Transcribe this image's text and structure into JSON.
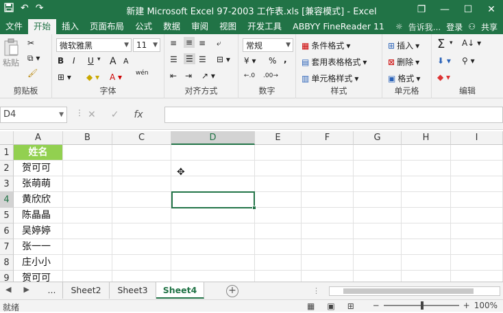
{
  "titlebar": {
    "title": "新建 Microsoft Excel 97-2003 工作表.xls  [兼容模式] - Excel",
    "save_icon": "save-icon",
    "undo": "↶",
    "redo": "↷",
    "restore": "❐",
    "minimize": "—",
    "maximize": "☐",
    "close": "✕"
  },
  "menu": {
    "tabs": [
      "文件",
      "开始",
      "插入",
      "页面布局",
      "公式",
      "数据",
      "审阅",
      "视图",
      "开发工具",
      "ABBYY FineReader 11"
    ],
    "active_tab": "开始",
    "tell_me": "告诉我...",
    "login": "登录",
    "share": "共享"
  },
  "ribbon": {
    "clipboard": {
      "label": "剪贴板",
      "paste": "粘贴"
    },
    "font": {
      "label": "字体",
      "font_name": "微软雅黑",
      "font_size": "11",
      "bold": "B",
      "italic": "I",
      "underline": "U",
      "grow": "A",
      "shrink": "A",
      "phonetic": "wén"
    },
    "alignment": {
      "label": "对齐方式"
    },
    "number": {
      "label": "数字",
      "format": "常规",
      "percent": "%",
      "comma": ","
    },
    "styles": {
      "label": "样式",
      "conditional": "条件格式",
      "table": "套用表格格式",
      "cell_styles": "单元格样式"
    },
    "cells": {
      "label": "单元格",
      "insert": "插入",
      "delete": "删除",
      "format": "格式"
    },
    "editing": {
      "label": "编辑",
      "sum": "Σ"
    }
  },
  "formula_bar": {
    "name_box": "D4",
    "cancel": "✕",
    "enter": "✓",
    "fx": "fx",
    "content": ""
  },
  "columns": [
    "A",
    "B",
    "C",
    "D",
    "E",
    "F",
    "G",
    "H",
    "I"
  ],
  "selected_column": "D",
  "rows": [
    {
      "num": "1",
      "a": "姓名"
    },
    {
      "num": "2",
      "a": "贺可可"
    },
    {
      "num": "3",
      "a": "张萌萌"
    },
    {
      "num": "4",
      "a": "黄欣欣"
    },
    {
      "num": "5",
      "a": "陈晶晶"
    },
    {
      "num": "6",
      "a": "吴婷婷"
    },
    {
      "num": "7",
      "a": "张一一"
    },
    {
      "num": "8",
      "a": "庄小小"
    },
    {
      "num": "9",
      "a": "贺可可"
    }
  ],
  "selected_row": "4",
  "header_fill": "#92d050",
  "accent": "#217346",
  "sheets": {
    "overflow": "...",
    "tabs": [
      "Sheet2",
      "Sheet3",
      "Sheet4"
    ],
    "active": "Sheet4",
    "add": "+"
  },
  "status": {
    "ready": "就绪",
    "zoom": "100%",
    "minus": "−",
    "plus": "+"
  }
}
